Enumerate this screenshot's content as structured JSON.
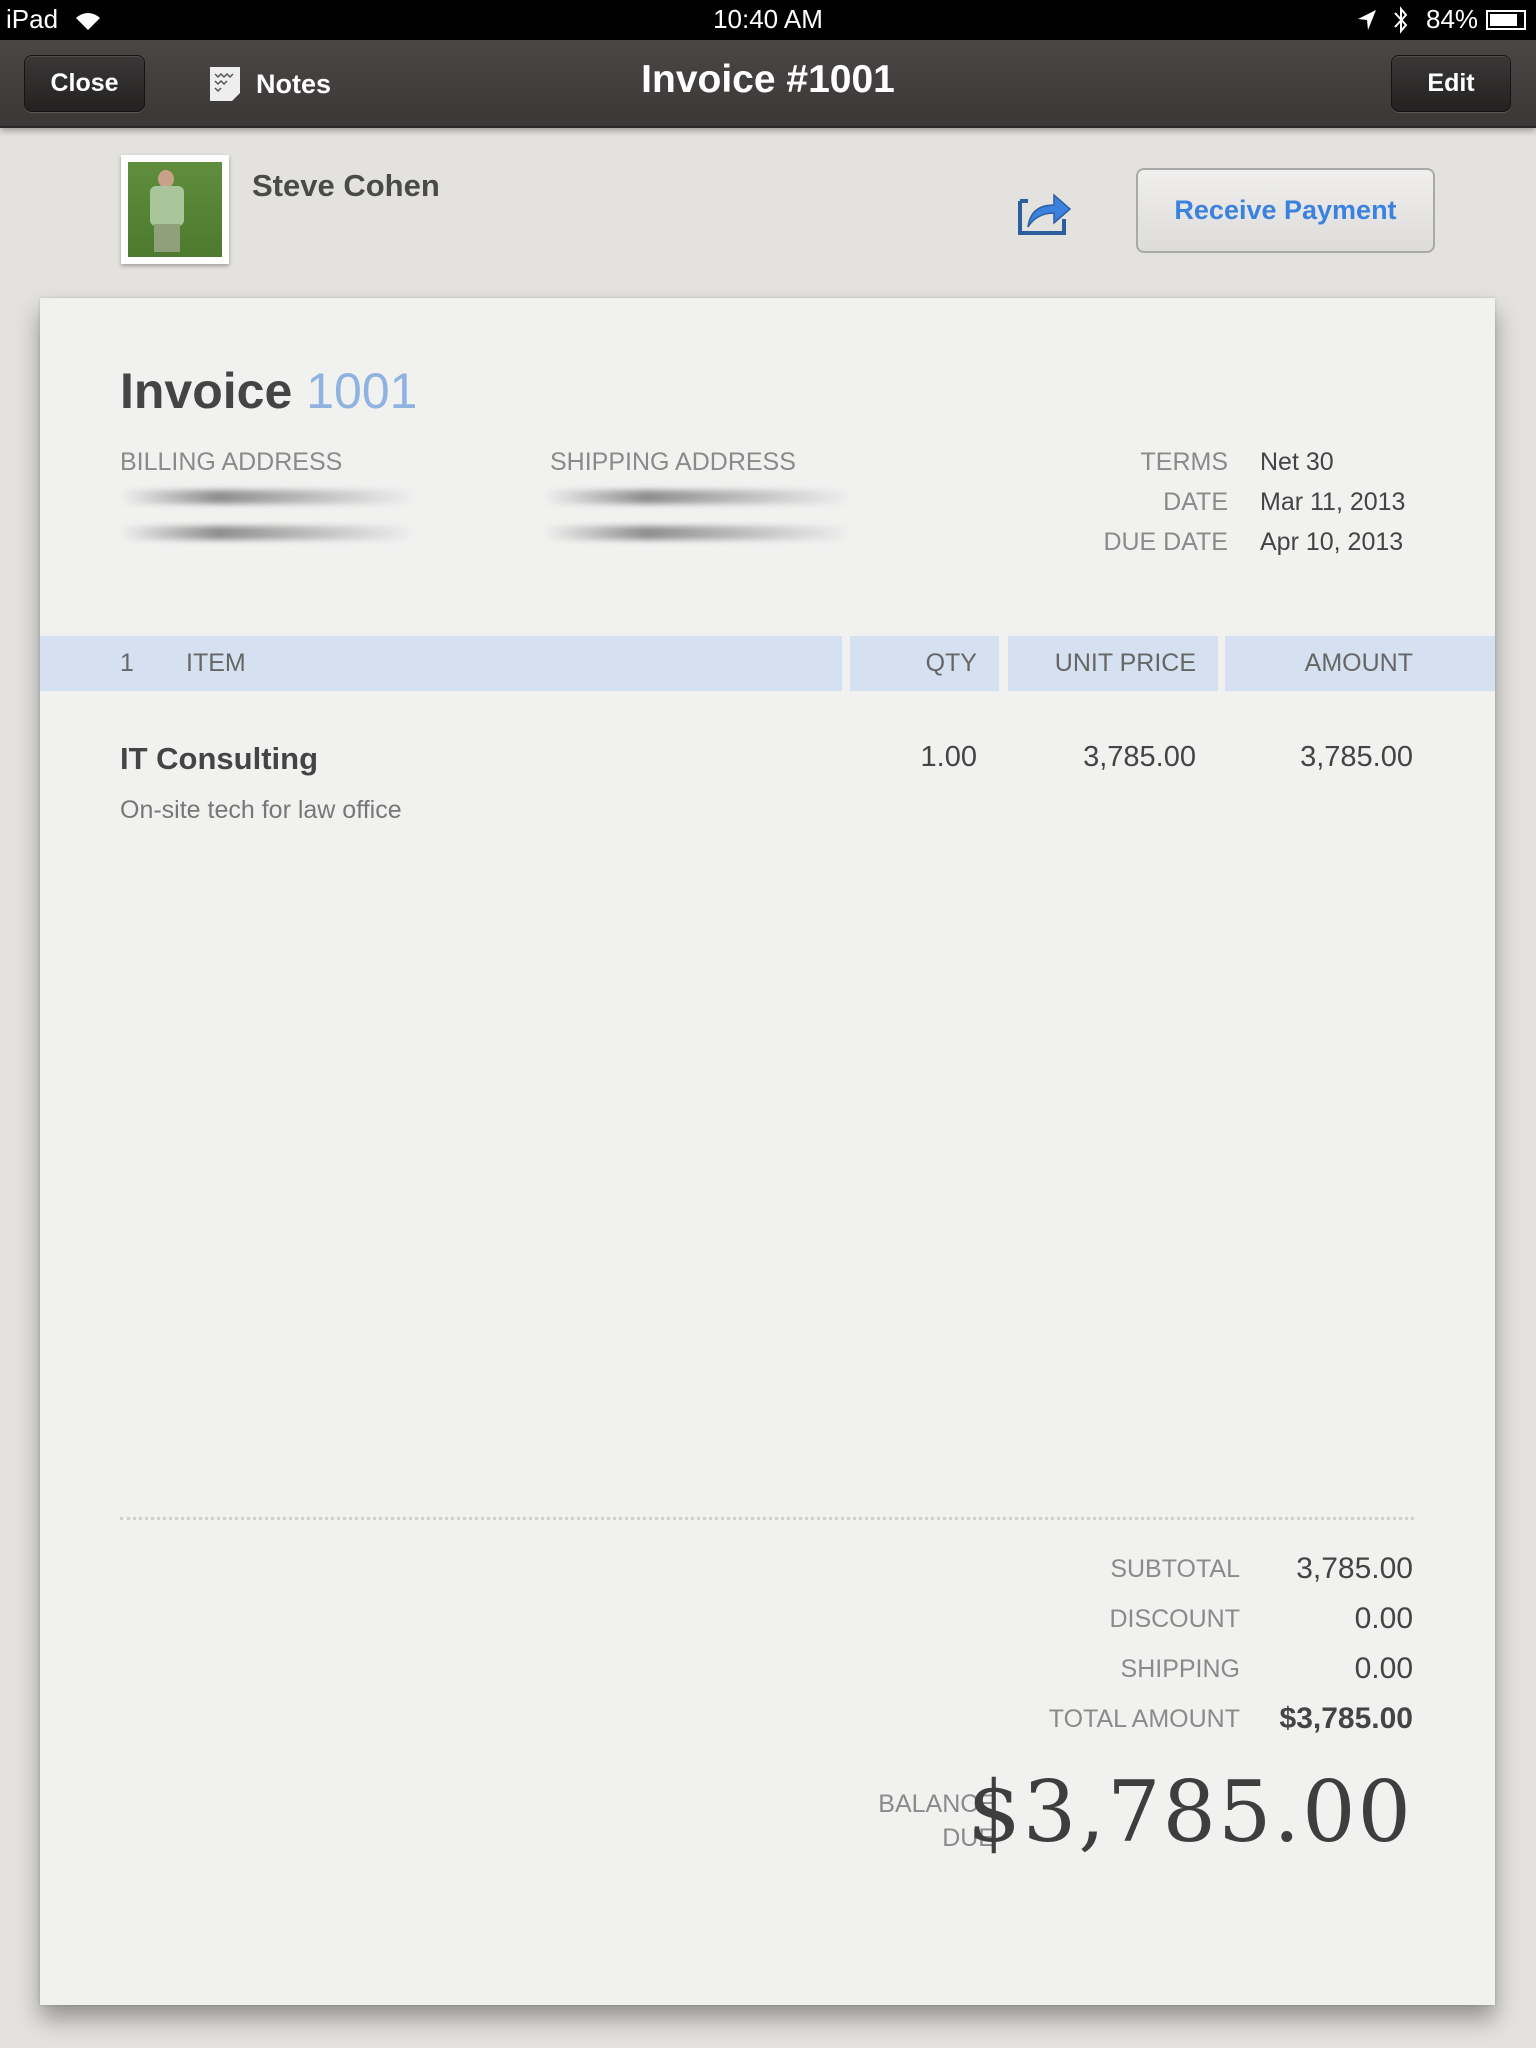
{
  "status_bar": {
    "device": "iPad",
    "time": "10:40 AM",
    "battery": "84%",
    "icons": [
      "wifi-icon",
      "location-icon",
      "bluetooth-icon",
      "battery-icon"
    ]
  },
  "nav": {
    "close_label": "Close",
    "notes_label": "Notes",
    "title": "Invoice #1001",
    "edit_label": "Edit"
  },
  "customer": {
    "name": "Steve Cohen"
  },
  "actions": {
    "receive_payment_label": "Receive Payment",
    "accent": "#3b82e0"
  },
  "invoice": {
    "heading_word": "Invoice",
    "number": "1001",
    "billing_label": "BILLING ADDRESS",
    "shipping_label": "SHIPPING ADDRESS",
    "meta": [
      {
        "label": "TERMS",
        "value": "Net 30"
      },
      {
        "label": "DATE",
        "value": "Mar 11, 2013"
      },
      {
        "label": "DUE DATE",
        "value": "Apr 10, 2013"
      }
    ],
    "table": {
      "count": "1",
      "headers": {
        "item": "ITEM",
        "qty": "QTY",
        "unit_price": "UNIT PRICE",
        "amount": "AMOUNT"
      },
      "rows": [
        {
          "item": "IT Consulting",
          "description": "On-site tech for law office",
          "qty": "1.00",
          "unit_price": "3,785.00",
          "amount": "3,785.00"
        }
      ]
    },
    "totals": [
      {
        "label": "SUBTOTAL",
        "value": "3,785.00"
      },
      {
        "label": "DISCOUNT",
        "value": "0.00"
      },
      {
        "label": "SHIPPING",
        "value": "0.00"
      },
      {
        "label": "TOTAL AMOUNT",
        "value": "$3,785.00"
      }
    ],
    "balance_due_label_1": "BALANCE",
    "balance_due_label_2": "DUE",
    "balance_due": "$3,785.00"
  }
}
